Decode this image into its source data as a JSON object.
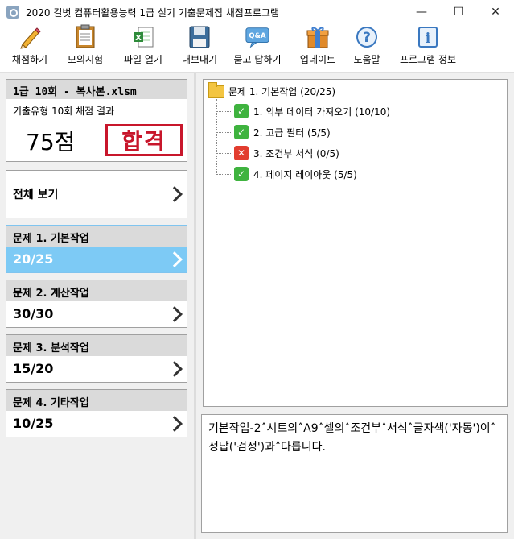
{
  "window": {
    "title": "2020 길벗 컴퓨터활용능력 1급 실기 기출문제집 채점프로그램",
    "minimize": "—",
    "maximize": "☐",
    "close": "✕"
  },
  "toolbar": {
    "items": [
      {
        "label": "채점하기",
        "icon": "pencil-icon"
      },
      {
        "label": "모의시험",
        "icon": "clipboard-icon"
      },
      {
        "label": "파일 열기",
        "icon": "excel-file-icon"
      },
      {
        "label": "내보내기",
        "icon": "floppy-disk-icon"
      },
      {
        "label": "묻고 답하기",
        "icon": "qa-bubble-icon"
      },
      {
        "label": "업데이트",
        "icon": "gift-box-icon"
      },
      {
        "label": "도움말",
        "icon": "help-circle-icon"
      },
      {
        "label": "프로그램 정보",
        "icon": "info-icon"
      }
    ]
  },
  "summary": {
    "filename": "1급 10회 - 복사본.xlsm",
    "exam_type": "기출유형 10회 채점 결과",
    "score": "75점",
    "stamp": "합격"
  },
  "overall": {
    "label": "전체 보기"
  },
  "problems": [
    {
      "title": "문제 1. 기본작업",
      "score": "20/25",
      "active": true
    },
    {
      "title": "문제 2. 계산작업",
      "score": "30/30",
      "active": false
    },
    {
      "title": "문제 3. 분석작업",
      "score": "15/20",
      "active": false
    },
    {
      "title": "문제 4. 기타작업",
      "score": "10/25",
      "active": false
    }
  ],
  "tree": {
    "root": "문제 1. 기본작업 (20/25)",
    "items": [
      {
        "label": "1. 외부 데이터 가져오기 (10/10)",
        "status": "ok"
      },
      {
        "label": "2. 고급 필터 (5/5)",
        "status": "ok"
      },
      {
        "label": "3. 조건부 서식 (0/5)",
        "status": "fail"
      },
      {
        "label": "4. 페이지 레이아웃 (5/5)",
        "status": "ok"
      }
    ]
  },
  "message": "기본작업-2˄시트의˄A9˄셀의˄조건부˄서식˄글자색('자동')이˄정답('검정')과˄다릅니다.",
  "colors": {
    "accent": "#7dcaf5",
    "stamp": "#c8162b",
    "ok": "#3fb33f",
    "fail": "#e23d2f"
  }
}
